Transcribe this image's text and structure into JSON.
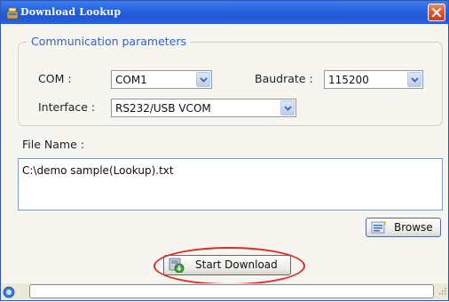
{
  "window": {
    "title": "Download Lookup"
  },
  "group": {
    "legend": "Communication parameters"
  },
  "com": {
    "label": "COM :",
    "value": "COM1"
  },
  "baudrate": {
    "label": "Baudrate :",
    "value": "115200"
  },
  "interface": {
    "label": "Interface :",
    "value": "RS232/USB VCOM"
  },
  "file": {
    "label": "File Name :",
    "path": "C:\\demo sample(Lookup).txt"
  },
  "buttons": {
    "browse": "Browse",
    "start": "Start Download"
  },
  "statusbar": {
    "text": ""
  },
  "colors": {
    "titlebar": "#2a64de",
    "accent_label": "#2f62c8",
    "highlight": "#e02a2a"
  }
}
